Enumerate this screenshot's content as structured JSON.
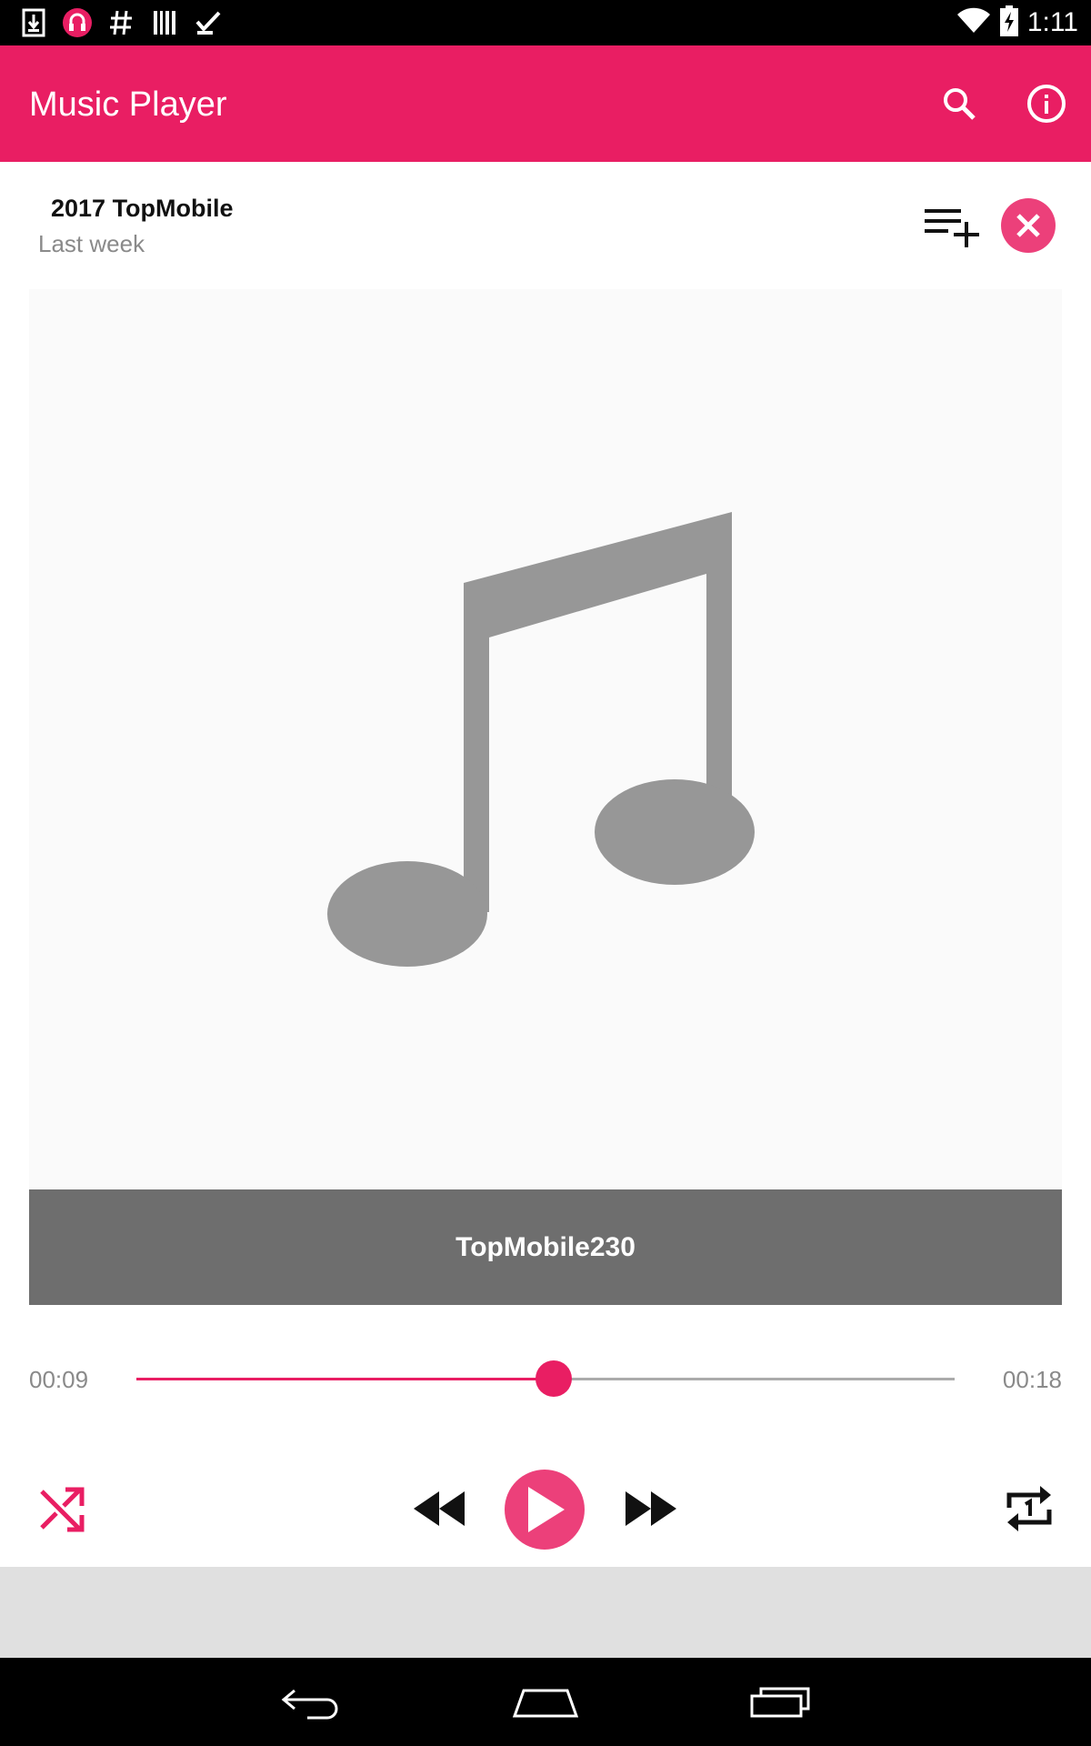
{
  "status_bar": {
    "time": "1:11",
    "icons_left": [
      "download-icon",
      "headphones-icon",
      "hashtag-icon",
      "barcode-icon",
      "checklist-icon"
    ],
    "icons_right": [
      "wifi-icon",
      "battery-charging-icon"
    ]
  },
  "app_bar": {
    "title": "Music Player",
    "actions": [
      "search-icon",
      "info-icon"
    ],
    "color": "#e91e63"
  },
  "playlist": {
    "title": "2017 TopMobile",
    "subtitle": "Last week"
  },
  "now_playing": {
    "song_title": "TopMobile230",
    "artwork_icon": "music-note-icon"
  },
  "progress": {
    "current_time": "00:09",
    "total_time": "00:18",
    "fraction": 0.51
  },
  "controls": [
    "shuffle-icon",
    "rewind-icon",
    "play-icon",
    "fast-forward-icon",
    "repeat-one-icon"
  ],
  "accent_color": "#ec407a",
  "nav_bar": [
    "back-icon",
    "home-icon",
    "recents-icon"
  ]
}
